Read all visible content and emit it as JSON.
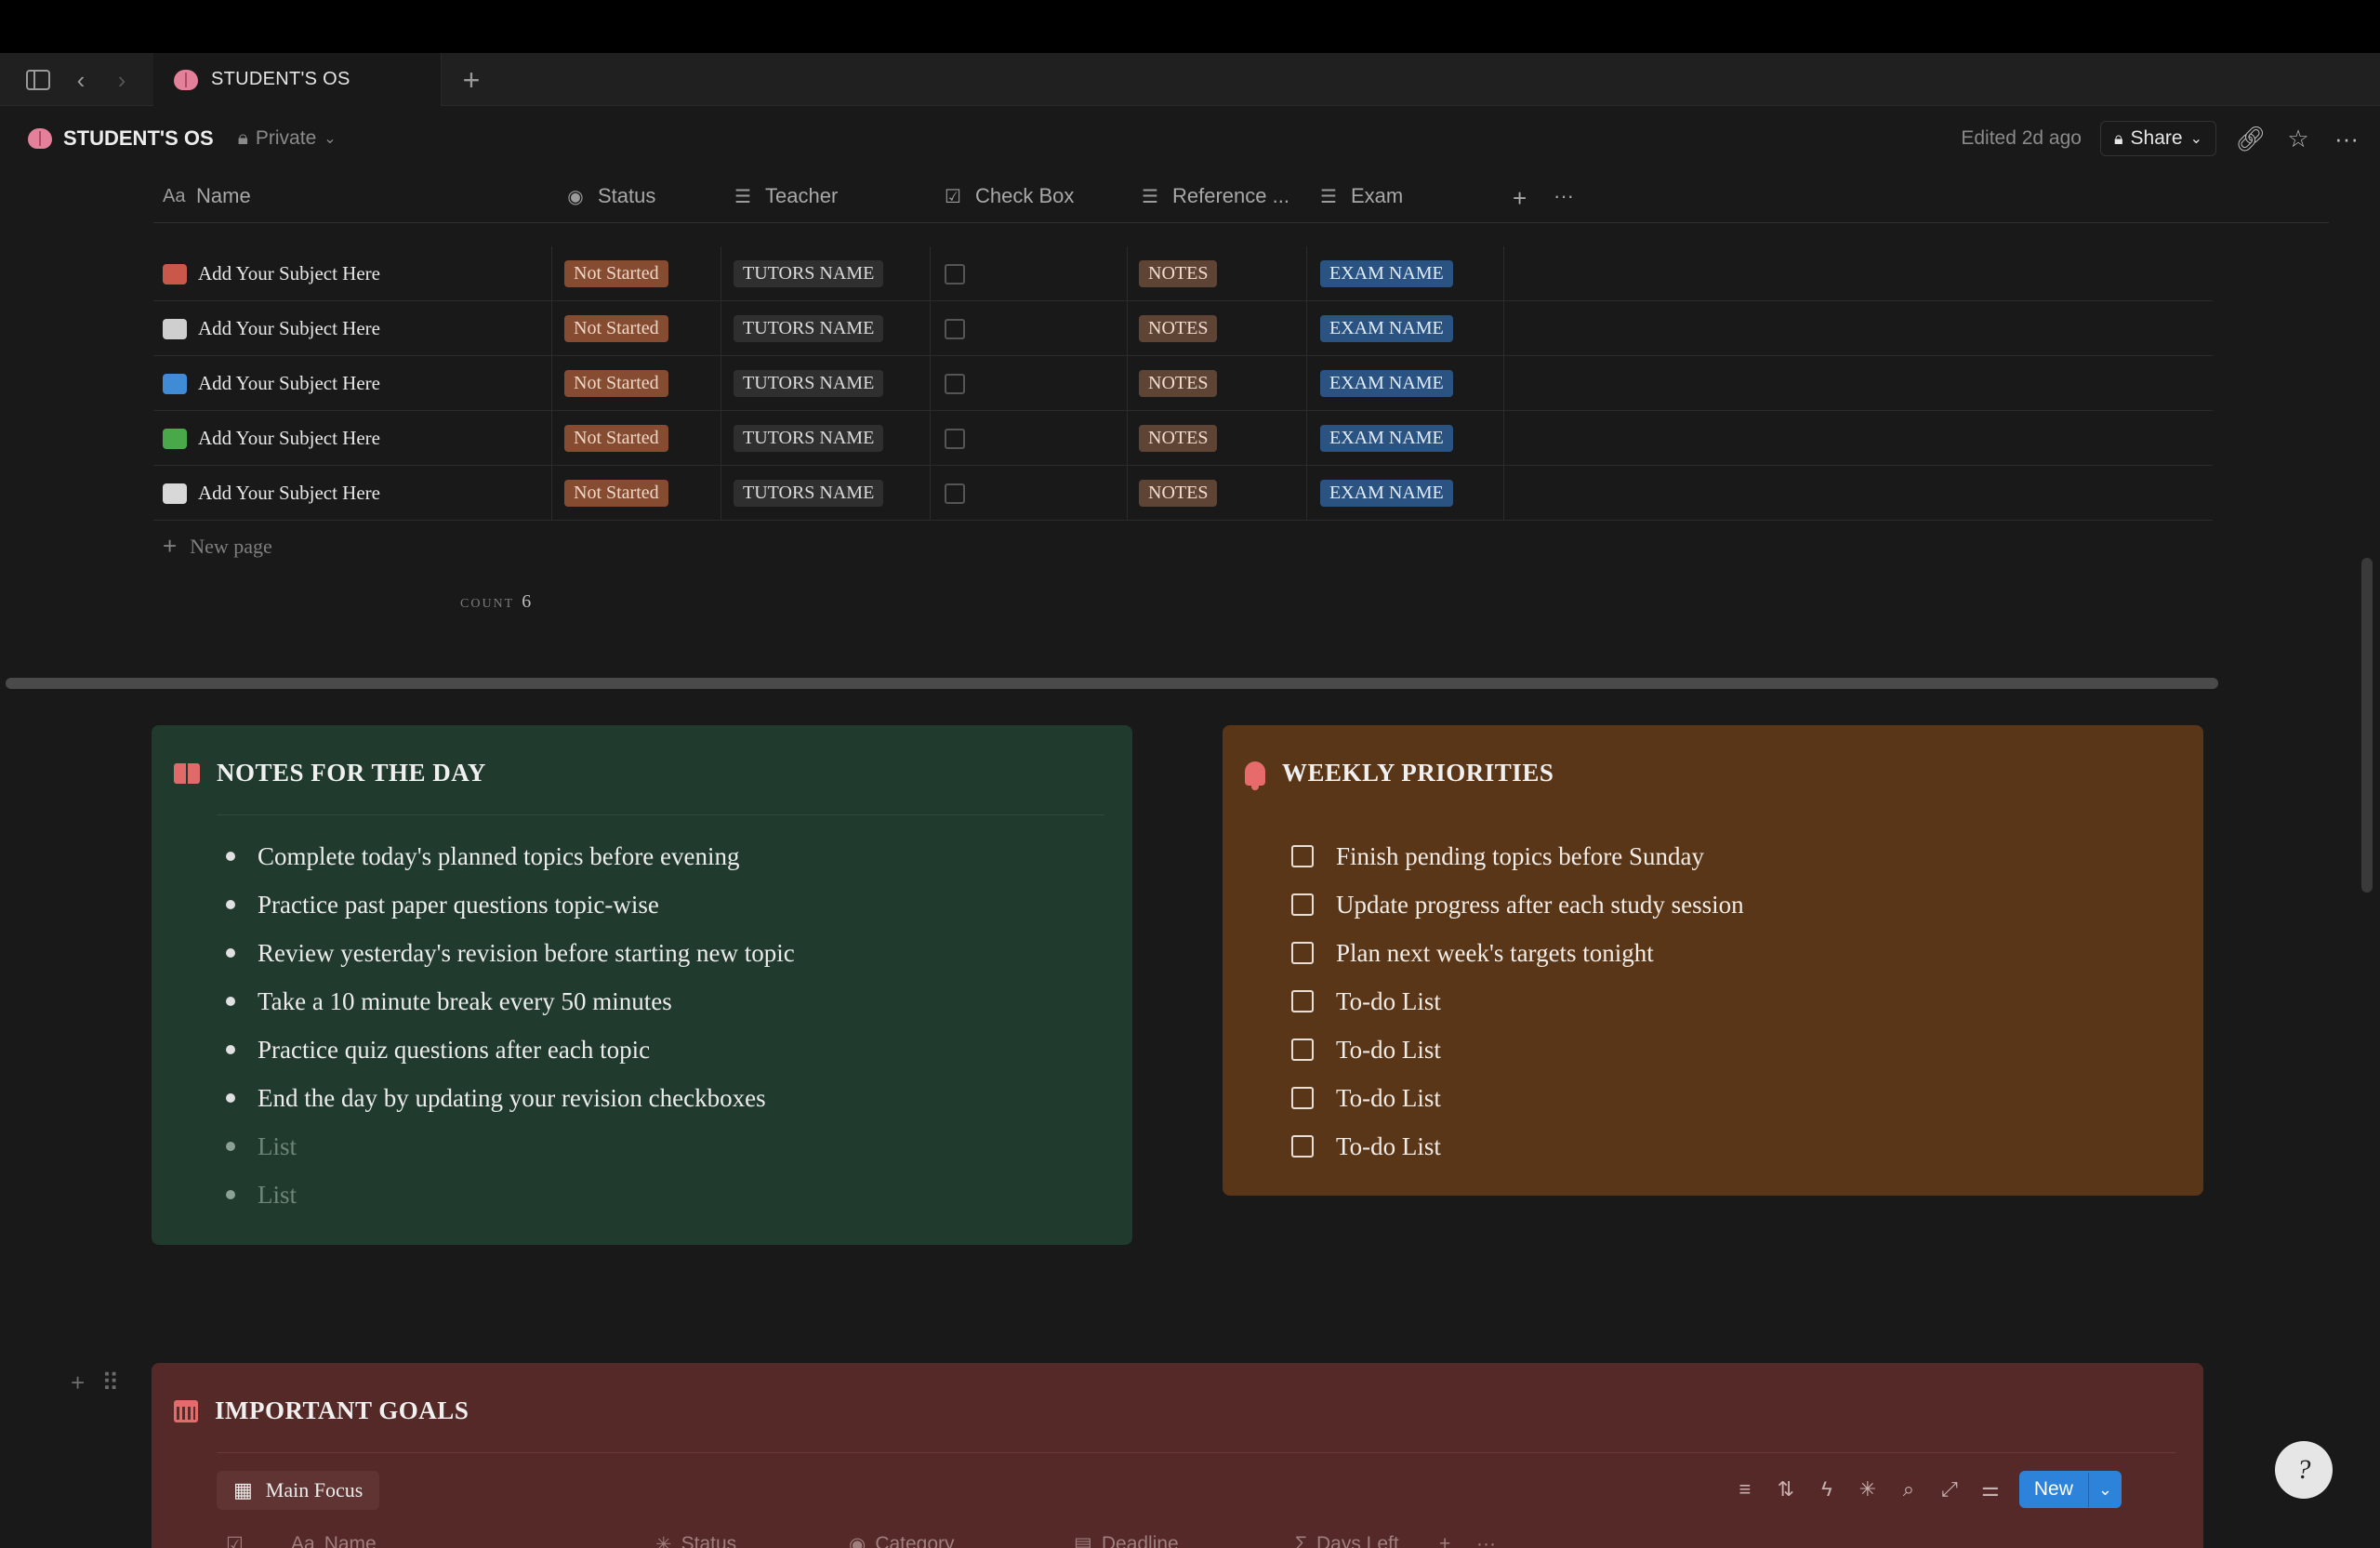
{
  "tab": {
    "title": "STUDENT'S OS"
  },
  "header": {
    "title": "STUDENT'S OS",
    "privacy": "Private",
    "edited": "Edited 2d ago",
    "share_label": "Share"
  },
  "table": {
    "columns": {
      "name": "Name",
      "status": "Status",
      "teacher": "Teacher",
      "checkbox": "Check Box",
      "reference": "Reference ...",
      "exam": "Exam"
    },
    "rows": [
      {
        "name": "Add Your Subject Here",
        "icon": "books-icon",
        "status": "Not Started",
        "teacher": "TUTORS NAME",
        "reference": "NOTES",
        "exam": "EXAM NAME"
      },
      {
        "name": "Add Your Subject Here",
        "icon": "newspaper-icon",
        "status": "Not Started",
        "teacher": "TUTORS NAME",
        "reference": "NOTES",
        "exam": "EXAM NAME"
      },
      {
        "name": "Add Your Subject Here",
        "icon": "globe-icon",
        "status": "Not Started",
        "teacher": "TUTORS NAME",
        "reference": "NOTES",
        "exam": "EXAM NAME"
      },
      {
        "name": "Add Your Subject Here",
        "icon": "shamrock-icon",
        "status": "Not Started",
        "teacher": "TUTORS NAME",
        "reference": "NOTES",
        "exam": "EXAM NAME"
      },
      {
        "name": "Add Your Subject Here",
        "icon": "folder-icon",
        "status": "Not Started",
        "teacher": "TUTORS NAME",
        "reference": "NOTES",
        "exam": "EXAM NAME"
      }
    ],
    "new_page": "New page",
    "count_label": "COUNT",
    "count_value": "6"
  },
  "notes": {
    "title": "NOTES FOR THE DAY",
    "items": [
      "Complete today's planned topics before evening",
      "Practice past paper questions topic-wise",
      "Review yesterday's revision before starting new topic",
      "Take a 10 minute break every 50 minutes",
      "Practice quiz questions after each topic",
      "End the day by updating your revision checkboxes"
    ],
    "placeholders": [
      "List",
      "List"
    ]
  },
  "priorities": {
    "title": "WEEKLY PRIORITIES",
    "items": [
      "Finish pending topics before Sunday",
      "Update progress after each study session",
      "Plan next week's targets tonight",
      "To-do List",
      "To-do List",
      "To-do List",
      "To-do List"
    ]
  },
  "goals": {
    "title": "IMPORTANT GOALS",
    "view_label": "Main Focus",
    "new_label": "New",
    "columns": {
      "name": "Name",
      "status": "Status",
      "category": "Category",
      "deadline": "Deadline",
      "days_left": "Days Left"
    }
  },
  "colors": {
    "notes_bg": "#203a2d",
    "priorities_bg": "#5a3618",
    "goals_bg": "#552928",
    "status_tag": "#854c31",
    "exam_tag": "#2b5381",
    "accent": "#2c83d9"
  }
}
